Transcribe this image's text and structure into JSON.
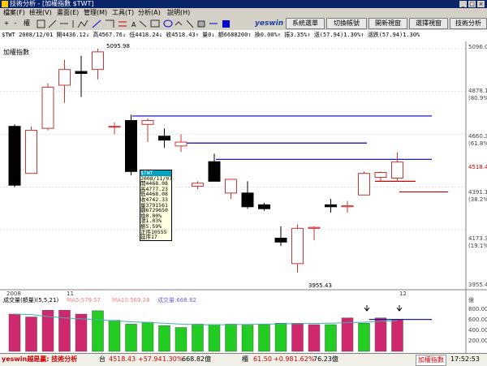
{
  "window": {
    "title": "技術分析 - [加權指數 $TWT]",
    "brand": "yeswin",
    "buttons": [
      "系統選單",
      "切換帳號",
      "開新視窗",
      "選擇視窗",
      "技術分析"
    ]
  },
  "menu": [
    "檔案(F)",
    "檢視(V)",
    "畫面(E)",
    "管理(M)",
    "工具(T)",
    "分析(A)",
    "說明(H)"
  ],
  "toolbar": {
    "left": [
      "+",
      "-",
      "權"
    ]
  },
  "header": {
    "info": "$TWT 2008/12/01 開4436.12↓ 高4567.76↓ 低4418.24↓ 收4518.43↑ 量0↓ 額6688200↑ 換0.00%↑ 振3.35%↑ 漲(57.94)1.30%↑ 漲跌(57.94)1.30%",
    "series_name": "加權指數"
  },
  "price_axis": {
    "ticks": [
      "5096.0",
      "4878.1",
      "(80.9%)",
      "4660.3",
      "(61.8%)",
      "4518.4",
      "4391.1",
      "(38.2%)",
      "4173.3",
      "(19.1%)",
      "3955.4"
    ],
    "current": "4518.4"
  },
  "annotations": {
    "high": "5095.98",
    "low": "3955.43"
  },
  "date_labels": [
    "2008",
    "11",
    "12"
  ],
  "tooltip": [
    "$TWT",
    "2008/11/07",
    "開4468.08",
    "高4777.23",
    "低4468.08",
    "收4742.33",
    "量3791561",
    "額6729650",
    "換0.00%",
    "漲1.03%",
    "振5.59%",
    "正序10555",
    "延序17"
  ],
  "volume": {
    "legend": "成交量(額量)(5,5,21)",
    "ma5": "MA5:579.57",
    "ma10": "MA10:569.28",
    "vol": "成交量:668.82",
    "axis": [
      "億",
      "800.00",
      "600.00",
      "400.00",
      "200.00"
    ]
  },
  "status": {
    "brand": "yeswin越是贏: 技術分析",
    "market": "台",
    "index": "4518.43",
    "change": "+57.94",
    "pct": "1.30%",
    "amount": "668.82億",
    "label2": "櫃",
    "index2": "61.50",
    "change2": "+0.98",
    "pct2": "1.62%",
    "amount2": "76.23億",
    "tab": "加權指數",
    "clock": "17:52:53"
  },
  "colors": {
    "up": "#cc3333",
    "down": "#000000",
    "vol_up": "#d0286e",
    "vol_down": "#22cc22",
    "ma": "#1a1aa8"
  },
  "chart_data": [
    {
      "type": "candlestick",
      "title": "加權指數",
      "ylim": [
        3900,
        5150
      ],
      "candles": [
        {
          "o": 4700,
          "h": 4710,
          "l": 4390,
          "c": 4400
        },
        {
          "o": 4460,
          "h": 4700,
          "l": 4460,
          "c": 4680
        },
        {
          "o": 4690,
          "h": 4920,
          "l": 4680,
          "c": 4900
        },
        {
          "o": 4910,
          "h": 5040,
          "l": 4820,
          "c": 4990
        },
        {
          "o": 4980,
          "h": 5060,
          "l": 4850,
          "c": 4970
        },
        {
          "o": 4990,
          "h": 5096,
          "l": 4940,
          "c": 5080
        },
        {
          "o": 4700,
          "h": 4720,
          "l": 4660,
          "c": 4700
        },
        {
          "o": 4730,
          "h": 4760,
          "l": 4450,
          "c": 4470
        },
        {
          "o": 4710,
          "h": 4740,
          "l": 4620,
          "c": 4730
        },
        {
          "o": 4650,
          "h": 4690,
          "l": 4590,
          "c": 4630
        },
        {
          "o": 4600,
          "h": 4660,
          "l": 4570,
          "c": 4620
        },
        {
          "o": 4395,
          "h": 4420,
          "l": 4380,
          "c": 4410
        },
        {
          "o": 4520,
          "h": 4560,
          "l": 4420,
          "c": 4420
        },
        {
          "o": 4360,
          "h": 4430,
          "l": 4330,
          "c": 4430
        },
        {
          "o": 4360,
          "h": 4420,
          "l": 4280,
          "c": 4290
        },
        {
          "o": 4300,
          "h": 4310,
          "l": 4270,
          "c": 4280
        },
        {
          "o": 4130,
          "h": 4190,
          "l": 4090,
          "c": 4110
        },
        {
          "o": 4000,
          "h": 4200,
          "l": 3955,
          "c": 4180
        },
        {
          "o": 4180,
          "h": 4190,
          "l": 4120,
          "c": 4185
        },
        {
          "o": 4300,
          "h": 4330,
          "l": 4260,
          "c": 4290
        },
        {
          "o": 4290,
          "h": 4320,
          "l": 4260,
          "c": 4295
        },
        {
          "o": 4350,
          "h": 4470,
          "l": 4350,
          "c": 4460
        },
        {
          "o": 4440,
          "h": 4470,
          "l": 4420,
          "c": 4465
        },
        {
          "o": 4436,
          "h": 4568,
          "l": 4418,
          "c": 4518
        }
      ],
      "levels": [
        {
          "y": 4753,
          "color": "#0000cc"
        },
        {
          "y": 4615,
          "color": "#0000cc"
        },
        {
          "y": 4532,
          "color": "#0000cc"
        },
        {
          "y": 4420,
          "color": "#cc0000"
        },
        {
          "y": 4366,
          "color": "#cc0000"
        }
      ]
    },
    {
      "type": "bar",
      "title": "成交量(額量)(5,5,21)",
      "ylim": [
        0,
        950
      ],
      "values": [
        780,
        720,
        860,
        860,
        780,
        850,
        650,
        570,
        610,
        540,
        500,
        570,
        560,
        570,
        550,
        560,
        590,
        590,
        560,
        560,
        700,
        590,
        700,
        669
      ],
      "up": [
        1,
        1,
        1,
        1,
        1,
        0,
        0,
        0,
        0,
        0,
        0,
        0,
        0,
        0,
        0,
        0,
        0,
        1,
        1,
        0,
        1,
        0,
        1,
        1
      ],
      "ma": [
        780,
        770,
        730,
        700,
        680,
        660,
        640,
        620,
        605,
        590,
        570,
        560,
        555,
        560,
        565,
        570,
        575,
        580,
        585,
        590,
        600,
        610,
        630,
        640
      ]
    }
  ]
}
